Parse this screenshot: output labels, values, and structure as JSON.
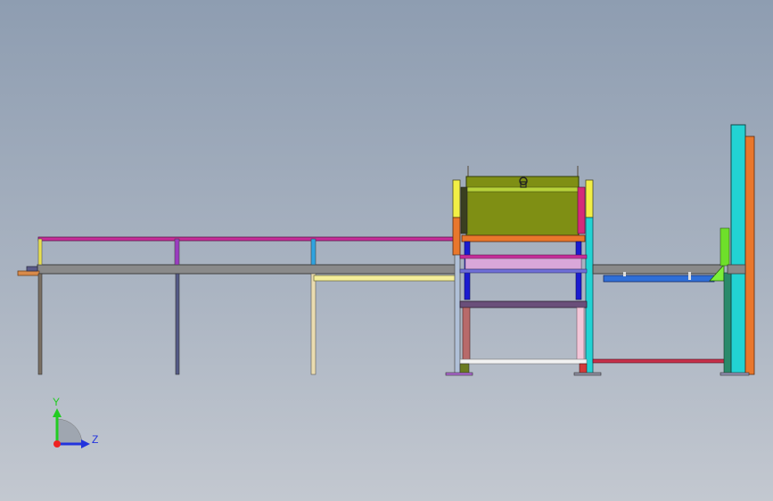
{
  "viewport": {
    "background_top": "#8e9db1",
    "background_bottom": "#c3c8d0"
  },
  "triad": {
    "y_label": "Y",
    "z_label": "Z",
    "y_color": "#22cc22",
    "z_color": "#2233dd",
    "origin_color": "#ee2222",
    "icon": "view-orientation-triad-icon"
  },
  "colors": {
    "frame_gray": "#6f6f6f",
    "magenta": "#c72d9a",
    "olive": "#8a9a1a",
    "cyan": "#22d3d3",
    "orange": "#e9772c",
    "blue": "#2f6fd8",
    "yellow": "#f2ef45",
    "red": "#d33a3a",
    "pink": "#e8a7c9",
    "green": "#6ee02a"
  }
}
